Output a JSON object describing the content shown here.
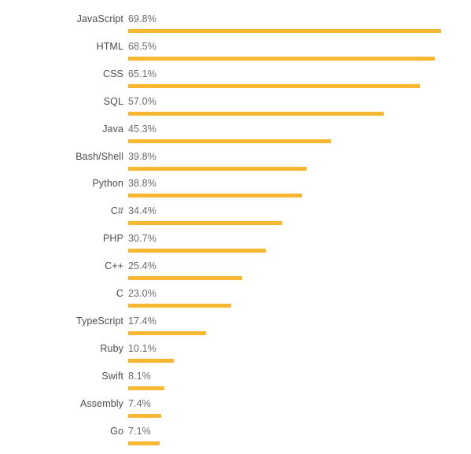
{
  "chart_data": {
    "type": "bar",
    "orientation": "horizontal",
    "title": "",
    "subtitle": "",
    "xlabel": "",
    "ylabel": "",
    "xlim": [
      0,
      73.5
    ],
    "grid": false,
    "legend": null,
    "value_suffix": "%",
    "bar_color": "#f7b731",
    "label_color": "#4c4c4c",
    "value_color": "#6b6b6b",
    "background": "#ffffff",
    "categories": [
      "JavaScript",
      "HTML",
      "CSS",
      "SQL",
      "Java",
      "Bash/Shell",
      "Python",
      "C#",
      "PHP",
      "C++",
      "C",
      "TypeScript",
      "Ruby",
      "Swift",
      "Assembly",
      "Go"
    ],
    "values": [
      69.8,
      68.5,
      65.1,
      57.0,
      45.3,
      39.8,
      38.8,
      34.4,
      30.7,
      25.4,
      23.0,
      17.4,
      10.1,
      8.1,
      7.4,
      7.1
    ],
    "value_labels": [
      "69.8%",
      "68.5%",
      "65.1%",
      "57.0%",
      "45.3%",
      "39.8%",
      "38.8%",
      "34.4%",
      "30.7%",
      "25.4%",
      "23.0%",
      "17.4%",
      "10.1%",
      "8.1%",
      "7.4%",
      "7.1%"
    ]
  }
}
